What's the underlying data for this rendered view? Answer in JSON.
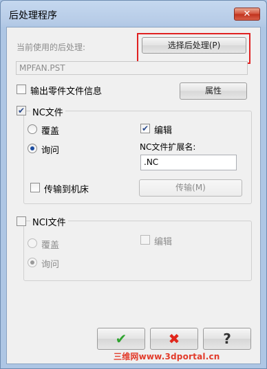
{
  "window": {
    "title": "后处理程序",
    "close_label": "✕"
  },
  "current_post": {
    "label": "当前使用的后处理:",
    "select_button": "选择后处理(P)",
    "value": "MPFAN.PST"
  },
  "output_info": {
    "label": "输出零件文件信息",
    "checked": false,
    "properties_button": "属性"
  },
  "nc_file": {
    "label": "NC文件",
    "checked": true,
    "overwrite_label": "覆盖",
    "overwrite_selected": false,
    "ask_label": "询问",
    "ask_selected": true,
    "edit_label": "编辑",
    "edit_checked": true,
    "ext_label": "NC文件扩展名:",
    "ext_value": ".NC",
    "transfer_label": "传输到机床",
    "transfer_checked": false,
    "transfer_button": "传输(M)"
  },
  "nci_file": {
    "label": "NCI文件",
    "checked": false,
    "overwrite_label": "覆盖",
    "ask_label": "询问",
    "ask_selected": true,
    "edit_label": "编辑",
    "edit_checked": false
  },
  "footer": {
    "ok_icon": "check-icon",
    "cancel_icon": "x-icon",
    "help_icon": "question-icon",
    "ok_glyph": "✔",
    "cancel_glyph": "✖",
    "help_glyph": "?"
  },
  "watermark": "三维网www.3dportal.cn",
  "colors": {
    "ok": "#2fa32f",
    "cancel": "#e0261b",
    "highlight": "#e02020"
  }
}
